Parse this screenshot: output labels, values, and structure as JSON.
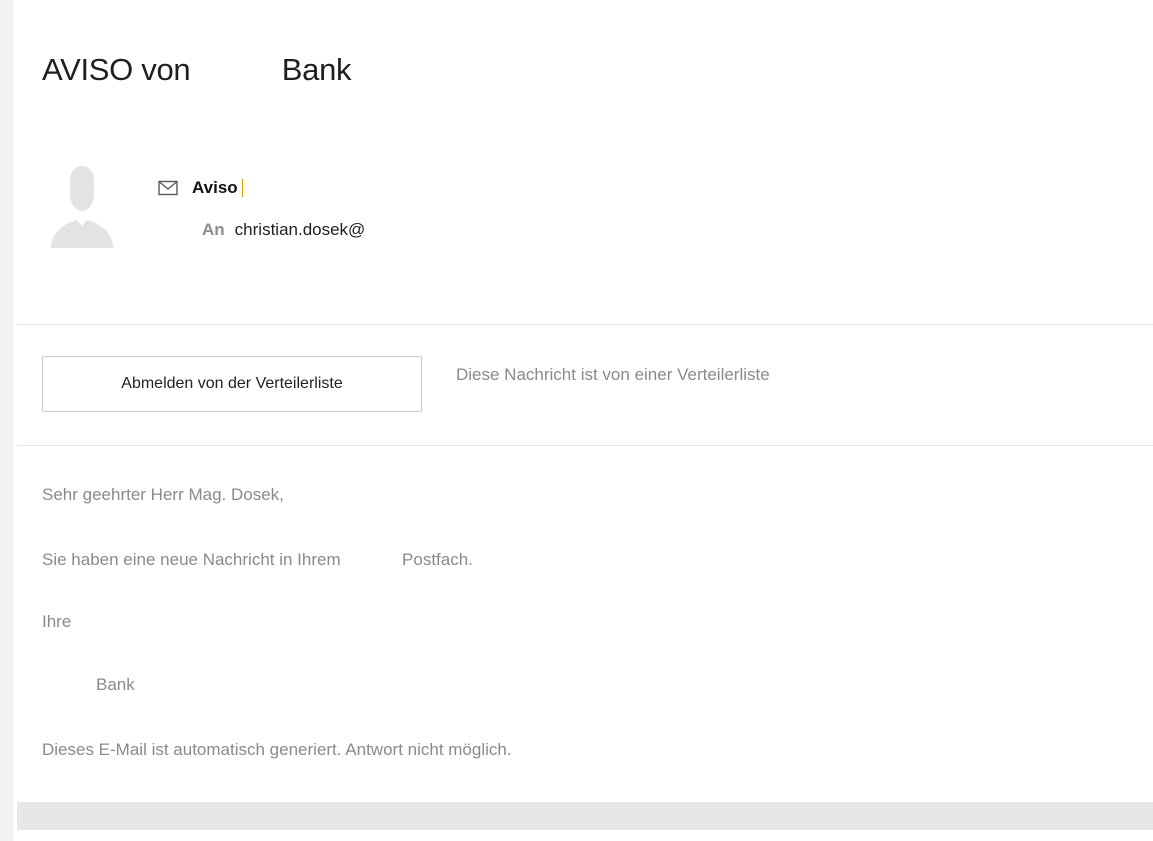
{
  "message": {
    "subject": "AVISO von           Bank",
    "sender": {
      "name": "Aviso"
    },
    "recipient": {
      "label": "An",
      "address": "christian.dosek@"
    }
  },
  "mailing_list": {
    "unsubscribe_label": "Abmelden von der Verteilerliste",
    "note": "Diese Nachricht ist von einer Verteilerliste"
  },
  "body": {
    "greeting": "Sehr geehrter Herr Mag. Dosek,",
    "new_message": "Sie haben eine neue Nachricht in Ihrem             Postfach.",
    "closing": "Ihre",
    "signature": "Bank",
    "auto_note": "Dieses E-Mail ist automatisch generiert. Antwort nicht möglich."
  },
  "icons": {
    "avatar": "person-placeholder-icon",
    "sender": "envelope-icon"
  },
  "colors": {
    "muted_text": "#8a8a8a",
    "divider": "#e6e6e6",
    "footer_bar": "#e7e7e7"
  }
}
